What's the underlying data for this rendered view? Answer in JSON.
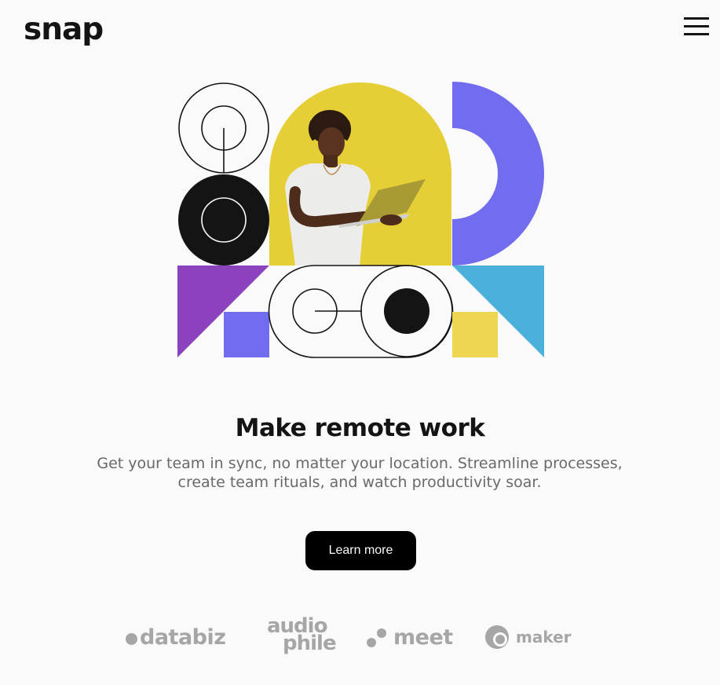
{
  "header": {
    "logo": "snap",
    "menu_icon": "hamburger-menu-icon"
  },
  "hero": {
    "illustration": "person-with-laptop-illustration",
    "colors": {
      "yellow": "#E6CF36",
      "indigo": "#726CEE",
      "purple": "#8C42BD",
      "sky": "#4BB1DA",
      "gold": "#EFD652",
      "ink": "#141414"
    },
    "headline": "Make remote work",
    "subtext": "Get your team in sync, no matter your location. Streamline processes, create team rituals, and watch productivity soar.",
    "cta_label": "Learn more"
  },
  "partners": {
    "databiz": "databiz",
    "audiophile_line1": "audio",
    "audiophile_line2": "phile",
    "meet": "meet",
    "maker": "maker"
  }
}
